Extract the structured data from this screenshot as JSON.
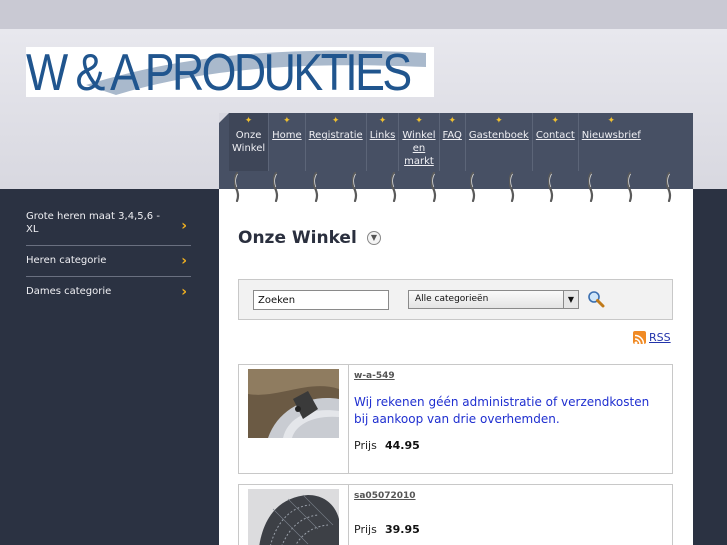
{
  "site": {
    "logo_text": "W & A PRODUKTIES",
    "brand_color": "#20558e"
  },
  "nav": {
    "items": [
      {
        "label": "Onze\nWinkel",
        "active": true
      },
      {
        "label": "Home"
      },
      {
        "label": "Registratie"
      },
      {
        "label": "Links"
      },
      {
        "label": "Winkel\nen\nmarkt"
      },
      {
        "label": "FAQ"
      },
      {
        "label": "Gastenboek"
      },
      {
        "label": "Contact"
      },
      {
        "label": "Nieuwsbrief"
      }
    ],
    "icon": "star-icon"
  },
  "sidebar": {
    "items": [
      {
        "label": "Grote heren maat 3,4,5,6 - XL"
      },
      {
        "label": "Heren categorie"
      },
      {
        "label": "Dames categorie"
      }
    ],
    "chevron_color": "#f0b020"
  },
  "main": {
    "title": "Onze Winkel",
    "search": {
      "value": "Zoeken",
      "category_selected": "Alle categorieën"
    },
    "rss_label": "RSS",
    "products": [
      {
        "code": "w-a-549",
        "description": "Wij rekenen géén administratie of verzendkosten bij aankoop van drie overhemden.",
        "price_label": "Prijs",
        "price": "44.95"
      },
      {
        "code": "sa05072010",
        "description": "",
        "price_label": "Prijs",
        "price": "39.95"
      }
    ]
  }
}
